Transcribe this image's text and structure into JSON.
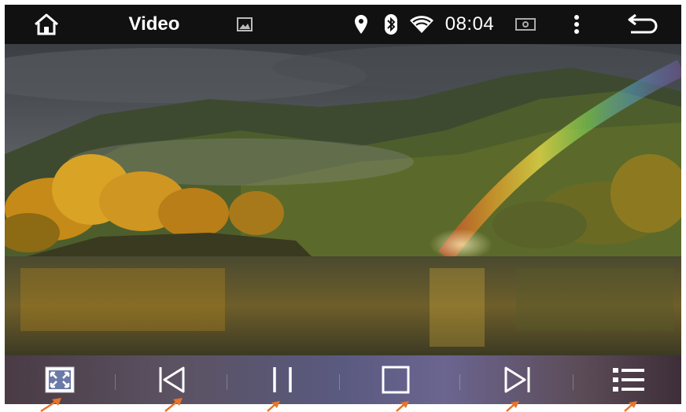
{
  "status_bar": {
    "app_title": "Video",
    "time": "08:04",
    "icons": [
      "home-icon",
      "gallery-icon",
      "location-icon",
      "bluetooth-icon",
      "wifi-icon",
      "screen-icon",
      "more-icon",
      "back-icon"
    ]
  },
  "controls": {
    "buttons": [
      "fullscreen-button",
      "previous-button",
      "pause-button",
      "stop-button",
      "next-button",
      "playlist-button"
    ]
  },
  "colors": {
    "status_bar_bg": "#111111",
    "arrow": "#e8742a"
  }
}
